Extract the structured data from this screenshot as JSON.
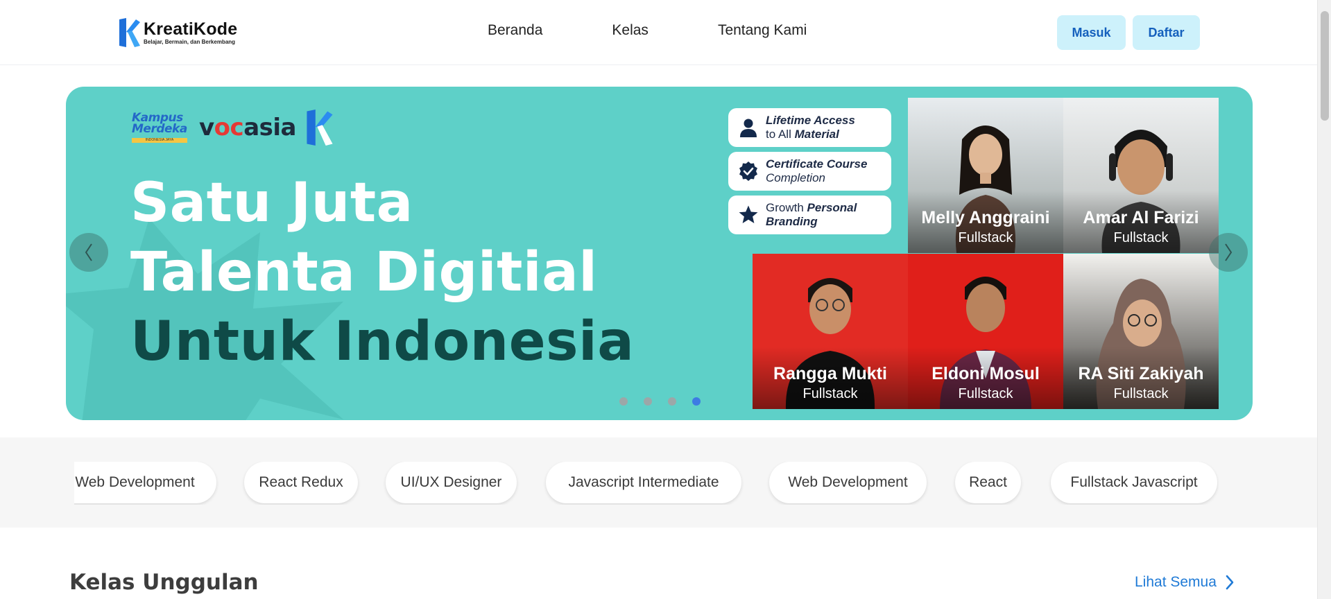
{
  "brand": {
    "name": "KreatiKode",
    "tagline": "Belajar, Bermain, dan Berkembang"
  },
  "nav": {
    "links": [
      "Beranda",
      "Kelas",
      "Tentang Kami"
    ],
    "login": "Masuk",
    "register": "Daftar"
  },
  "hero": {
    "partners": {
      "kampus_line1": "Kampus",
      "kampus_line2": "Merdeka",
      "kampus_sub": "INDONESIA JAYA",
      "vocasia_pre": "v",
      "vocasia_oc": "oc",
      "vocasia_post": "asia"
    },
    "headline": [
      "Satu Juta",
      "Talenta Digitial",
      "Untuk Indonesia"
    ],
    "features": [
      {
        "pre": "",
        "bold": "Lifetime Access",
        "line2_pre": "to All ",
        "line2_bold": "Material"
      },
      {
        "pre": "",
        "bold": "Certificate Course",
        "line2_pre": "Completion",
        "line2_bold": ""
      },
      {
        "pre": "Growth ",
        "bold": "Personal",
        "line2_pre": "",
        "line2_bold": "Branding"
      }
    ],
    "people": [
      {
        "name": "Melly Anggraini",
        "role": "Fullstack"
      },
      {
        "name": "Amar Al Farizi",
        "role": "Fullstack"
      },
      {
        "name": "Rangga Mukti",
        "role": "Fullstack"
      },
      {
        "name": "Eldoni Mosul",
        "role": "Fullstack"
      },
      {
        "name": "RA Siti Zakiyah",
        "role": "Fullstack"
      }
    ],
    "slide_count": 4,
    "active_slide": 4
  },
  "tags": [
    "Web Development",
    "React Redux",
    "UI/UX Designer",
    "Javascript Intermediate",
    "Web Development",
    "React",
    "Fullstack Javascript"
  ],
  "section": {
    "title": "Kelas Unggulan",
    "see_all": "Lihat Semua"
  },
  "colors": {
    "hero_bg": "#5ed0c8",
    "headline_dark": "#0f4a47",
    "accent_blue": "#1f7ad6",
    "auth_button_bg": "#cdf1fb"
  }
}
